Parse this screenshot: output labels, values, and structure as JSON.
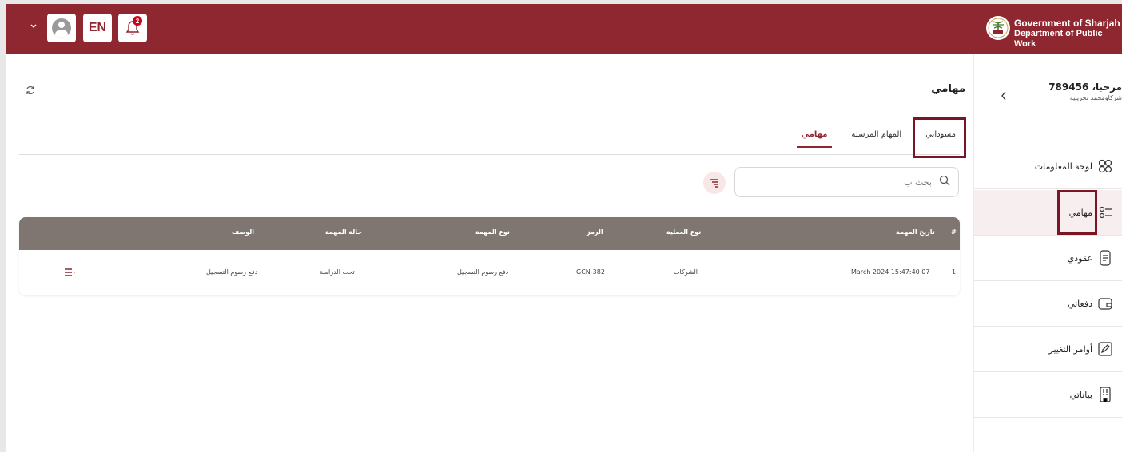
{
  "header": {
    "gov_line1": "Government of Sharjah",
    "gov_line2": "Department of Public Work",
    "lang_label": "EN",
    "notification_count": "2",
    "accent_color": "#8e2730"
  },
  "sidebar": {
    "welcome": "مرحبا، 789456",
    "company": "شركاومحمد تجريبية",
    "items": [
      {
        "label": "لوحة المعلومات",
        "icon": "dashboard-icon"
      },
      {
        "label": "مهامي",
        "icon": "tasks-icon"
      },
      {
        "label": "عقودي",
        "icon": "contracts-icon"
      },
      {
        "label": "دفعاتي",
        "icon": "wallet-icon"
      },
      {
        "label": "أوامر التغيير",
        "icon": "edit-icon"
      },
      {
        "label": "بياناتي",
        "icon": "building-icon"
      }
    ]
  },
  "main": {
    "title": "مهامي",
    "tabs": [
      {
        "label": "مهامي"
      },
      {
        "label": "المهام المرسلة"
      },
      {
        "label": "مسوداتي"
      }
    ],
    "search_placeholder": "ابحث ب",
    "table": {
      "headers": {
        "num": "#",
        "date": "تاريخ المهمة",
        "operation_type": "نوع العملية",
        "code": "الرمز",
        "task_type": "نوع المهمة",
        "status": "حالة المهمة",
        "description": "الوصف"
      },
      "rows": [
        {
          "num": "1",
          "date": "March 2024 15:47:40 07",
          "operation_type": "الشركات",
          "code": "GCN-382",
          "task_type": "دفع رسوم التسجيل",
          "status": "تحت الدراسة",
          "description": "دفع رسوم التسجيل"
        }
      ]
    }
  }
}
